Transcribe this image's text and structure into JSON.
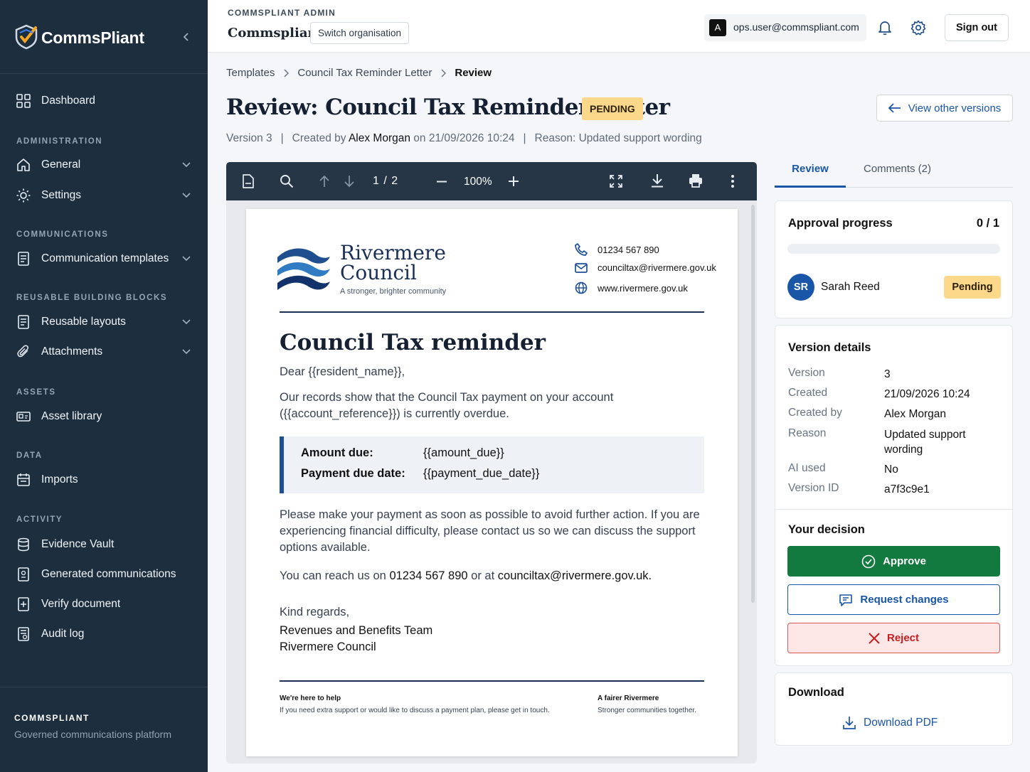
{
  "brand": {
    "name": "CommsPliant"
  },
  "sidebar": {
    "dashboard": "Dashboard",
    "sections": {
      "administration": "ADMINISTRATION",
      "communications": "COMMUNICATIONS",
      "reusable": "REUSABLE BUILDING BLOCKS",
      "assets": "ASSETS",
      "data": "DATA",
      "activity": "ACTIVITY"
    },
    "items": {
      "general": "General",
      "settings": "Settings",
      "templates": "Communication templates",
      "layouts": "Reusable layouts",
      "attachments": "Attachments",
      "asset_library": "Asset library",
      "imports": "Imports",
      "evidence": "Evidence Vault",
      "generated": "Generated communications",
      "verify": "Verify document",
      "audit": "Audit log"
    },
    "footer": {
      "title": "COMMSPLIANT",
      "subtitle": "Governed communications platform"
    }
  },
  "topbar": {
    "admin_label": "COMMSPLIANT ADMIN",
    "org_name": "Commspliant",
    "switch_org": "Switch organisation",
    "user_initial": "A",
    "user_email": "ops.user@commspliant.com",
    "sign_out": "Sign out"
  },
  "breadcrumb": [
    "Templates",
    "Council Tax Reminder Letter",
    "Review"
  ],
  "page": {
    "title": "Review: Council Tax Reminder Letter",
    "status": "PENDING",
    "view_versions": "View other versions",
    "meta": {
      "version": "Version 3",
      "created_prefix": "Created by",
      "author": "Alex Morgan",
      "on": "on 21/09/2026 10:24",
      "reason": "Reason: Updated support wording"
    }
  },
  "viewer": {
    "page_current": "1",
    "page_sep": "/",
    "page_total": "2",
    "zoom": "100%"
  },
  "letter": {
    "council_name_1": "Rivermere",
    "council_name_2": "Council",
    "tagline": "A stronger, brighter community",
    "phone": "01234 567 890",
    "email": "counciltax@rivermere.gov.uk",
    "website": "www.rivermere.gov.uk",
    "title": "Council Tax reminder",
    "greeting": "Dear {{resident_name}},",
    "p1_line1": "Our records show that the Council Tax payment on your account",
    "p1_line2": "({{account_reference}}) is currently overdue.",
    "amount_label": "Amount due:",
    "amount_value": "{{amount_due}}",
    "due_label": "Payment due date:",
    "due_value": "{{payment_due_date}}",
    "p2": "Please make your payment as soon as possible to avoid further action. If you are experiencing financial difficulty, please contact us so we can discuss the support options available.",
    "p3_prefix": "You can reach us on",
    "p3_phone": "01234 567 890",
    "p3_mid": "or at",
    "p3_email": "counciltax@rivermere.gov.uk.",
    "sign_1": "Kind regards,",
    "sign_2": "Revenues and Benefits Team",
    "sign_3": "Rivermere Council",
    "foot_left_title": "We're here to help",
    "foot_left_text": "If you need extra support or would like to discuss a payment plan, please get in touch.",
    "foot_right_title": "A fairer Rivermere",
    "foot_right_text": "Stronger communities together."
  },
  "panel": {
    "tab_review": "Review",
    "tab_comments": "Comments (2)",
    "progress_title": "Approval progress",
    "progress_count": "0 / 1",
    "progress_fraction": 0,
    "approver_initials": "SR",
    "approver_name": "Sarah Reed",
    "approver_status": "Pending",
    "details_title": "Version details",
    "details": [
      {
        "k": "Version",
        "v": "3"
      },
      {
        "k": "Created",
        "v": "21/09/2026 10:24"
      },
      {
        "k": "Created by",
        "v": "Alex Morgan"
      },
      {
        "k": "Reason",
        "v": "Updated support wording"
      },
      {
        "k": "AI used",
        "v": "No"
      },
      {
        "k": "Version ID",
        "v": "a7f3c9e1"
      }
    ],
    "decision_title": "Your decision",
    "approve": "Approve",
    "request_changes": "Request changes",
    "reject": "Reject",
    "download_title": "Download",
    "download_pdf": "Download PDF"
  },
  "colors": {
    "sidebar": "#1d2e3f",
    "accent": "#1a56a8",
    "approve": "#127a3f",
    "pending": "#fcd98a",
    "reject": "#c81e1e"
  }
}
